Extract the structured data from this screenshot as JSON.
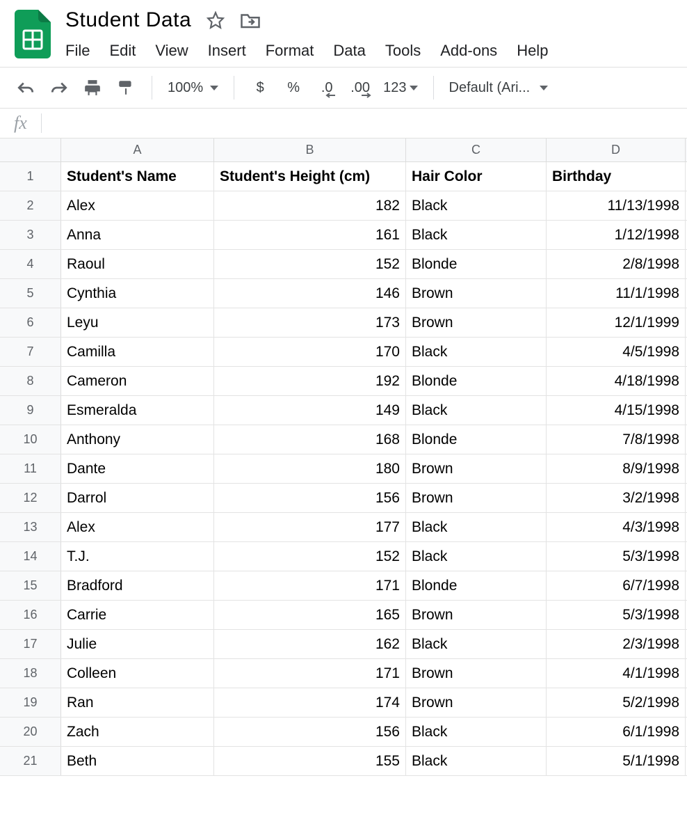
{
  "doc": {
    "title": "Student Data"
  },
  "menu": {
    "file": "File",
    "edit": "Edit",
    "view": "View",
    "insert": "Insert",
    "format": "Format",
    "data": "Data",
    "tools": "Tools",
    "addons": "Add-ons",
    "help": "Help"
  },
  "toolbar": {
    "zoom": "100%",
    "currency": "$",
    "percent": "%",
    "dec_decrease": ".0",
    "dec_increase": ".00",
    "format_more": "123",
    "font": "Default (Ari..."
  },
  "formula": {
    "fx": "fx",
    "value": ""
  },
  "columns": [
    "A",
    "B",
    "C",
    "D"
  ],
  "sheet": {
    "headers": [
      "Student's Name",
      "Student's Height (cm)",
      "Hair Color",
      "Birthday"
    ],
    "rows": [
      {
        "name": "Alex",
        "height": "182",
        "hair": "Black",
        "birthday": "11/13/1998"
      },
      {
        "name": "Anna",
        "height": "161",
        "hair": "Black",
        "birthday": "1/12/1998"
      },
      {
        "name": "Raoul",
        "height": "152",
        "hair": "Blonde",
        "birthday": "2/8/1998"
      },
      {
        "name": "Cynthia",
        "height": "146",
        "hair": "Brown",
        "birthday": "11/1/1998"
      },
      {
        "name": "Leyu",
        "height": "173",
        "hair": "Brown",
        "birthday": "12/1/1999"
      },
      {
        "name": "Camilla",
        "height": "170",
        "hair": "Black",
        "birthday": "4/5/1998"
      },
      {
        "name": "Cameron",
        "height": "192",
        "hair": "Blonde",
        "birthday": "4/18/1998"
      },
      {
        "name": "Esmeralda",
        "height": "149",
        "hair": "Black",
        "birthday": "4/15/1998"
      },
      {
        "name": "Anthony",
        "height": "168",
        "hair": "Blonde",
        "birthday": "7/8/1998"
      },
      {
        "name": "Dante",
        "height": "180",
        "hair": "Brown",
        "birthday": "8/9/1998"
      },
      {
        "name": "Darrol",
        "height": "156",
        "hair": "Brown",
        "birthday": "3/2/1998"
      },
      {
        "name": "Alex",
        "height": "177",
        "hair": "Black",
        "birthday": "4/3/1998"
      },
      {
        "name": "T.J.",
        "height": "152",
        "hair": "Black",
        "birthday": "5/3/1998"
      },
      {
        "name": "Bradford",
        "height": "171",
        "hair": "Blonde",
        "birthday": "6/7/1998"
      },
      {
        "name": "Carrie",
        "height": "165",
        "hair": "Brown",
        "birthday": "5/3/1998"
      },
      {
        "name": "Julie",
        "height": "162",
        "hair": "Black",
        "birthday": "2/3/1998"
      },
      {
        "name": "Colleen",
        "height": "171",
        "hair": "Brown",
        "birthday": "4/1/1998"
      },
      {
        "name": "Ran",
        "height": "174",
        "hair": "Brown",
        "birthday": "5/2/1998"
      },
      {
        "name": "Zach",
        "height": "156",
        "hair": "Black",
        "birthday": "6/1/1998"
      },
      {
        "name": "Beth",
        "height": "155",
        "hair": "Black",
        "birthday": "5/1/1998"
      }
    ]
  }
}
